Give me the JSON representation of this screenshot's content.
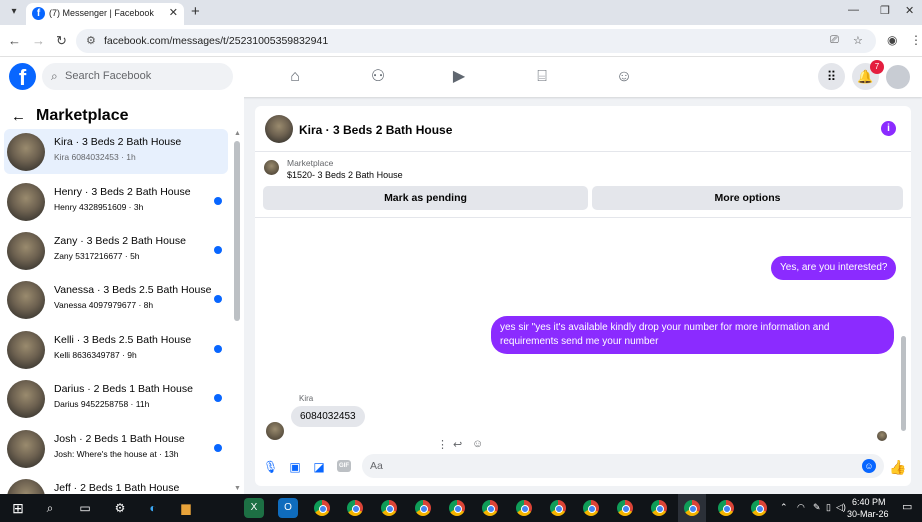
{
  "browser": {
    "tab_title": "(7) Messenger | Facebook",
    "tab_favicon": "f",
    "url": "facebook.com/messages/t/25231005359832941"
  },
  "fb": {
    "search_placeholder": "Search Facebook",
    "notifications_count": "7",
    "colors": {
      "brand": "#0866ff",
      "accent": "#8b2bff",
      "unread": "#0866ff",
      "badge": "#e41e3f"
    }
  },
  "sidebar": {
    "title": "Marketplace",
    "conversations": [
      {
        "title": "Kira · 3 Beds 2 Bath House",
        "subtitle": "Kira 6084032453 · 1h",
        "unread": false,
        "active": true
      },
      {
        "title": "Henry · 3 Beds 2 Bath House",
        "subtitle": "Henry 4328951609 · 3h",
        "unread": true
      },
      {
        "title": "Zany · 3 Beds 2 Bath House",
        "subtitle": "Zany 5317216677 · 5h",
        "unread": true
      },
      {
        "title": "Vanessa · 3 Beds 2.5 Bath House",
        "subtitle": "Vanessa 4097979677 · 8h",
        "unread": true
      },
      {
        "title": "Kelli · 3 Beds 2.5 Bath House",
        "subtitle": "Kelli 8636349787 · 9h",
        "unread": true
      },
      {
        "title": "Darius · 2 Beds 1 Bath House",
        "subtitle": "Darius 9452258758 · 11h",
        "unread": true
      },
      {
        "title": "Josh · 2 Beds 1 Bath House",
        "subtitle": "Josh: Where's the house at · 13h",
        "unread": true
      },
      {
        "title": "Jeff · 2 Beds 1 Bath House",
        "subtitle": "",
        "unread": false
      }
    ]
  },
  "chat": {
    "title": "Kira · 3 Beds 2 Bath House",
    "listing_label": "Marketplace",
    "listing_title": "$1520- 3 Beds 2 Bath House",
    "mark_pending": "Mark as pending",
    "more_options": "More options",
    "messages": [
      {
        "from": "me",
        "text": "Yes, are you interested?"
      },
      {
        "from": "me",
        "text": "yes sir \"yes it's available kindly drop your number for more information and requirements send me your number"
      },
      {
        "from": "Kira",
        "sender": "Kira",
        "text": "6084032453"
      }
    ],
    "composer_placeholder": "Aa",
    "gif_label": "GIF"
  },
  "taskbar": {
    "time": "6:40 PM",
    "date": "30-Mar-26"
  }
}
